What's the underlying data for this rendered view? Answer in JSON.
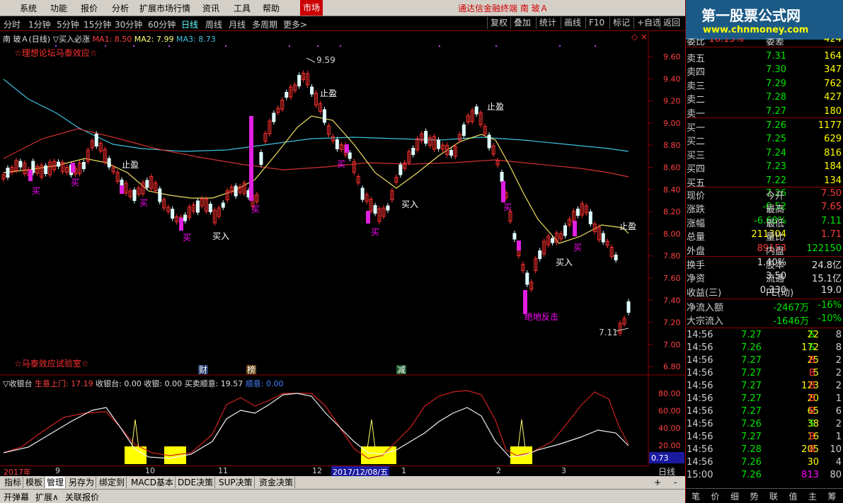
{
  "menu": [
    "系统",
    "功能",
    "报价",
    "分析",
    "扩展市场行情",
    "资讯",
    "工具",
    "帮助"
  ],
  "market_tag": "市场",
  "app_title": "通达信金融终端 南 玻Ａ",
  "periods": [
    "分时",
    "1分钟",
    "5分钟",
    "15分钟",
    "30分钟",
    "60分钟",
    "日线",
    "周线",
    "月线",
    "多周期",
    "更多>"
  ],
  "active_period": "日线",
  "toolbar": [
    "复权",
    "叠加",
    "统计",
    "画线",
    "F10",
    "标记",
    "+自选",
    "返回"
  ],
  "header": {
    "stock": "南 玻Ａ(日线)",
    "indicator": "▽买入必涨",
    "ma1": "MA1: 8.50",
    "ma2": "MA2: 7.99",
    "ma3": "MA3: 8.73"
  },
  "annotations": {
    "forum": "☆理想论坛马泰效应☆",
    "lab": "☆马泰效应试验室☆",
    "high_price": "9.59",
    "low_price": "7.11",
    "buy": "买",
    "buy_in": "买入",
    "stop_profit": "止盈",
    "rebound": "绝地反击",
    "event_cai": "财",
    "event_bang": "榜",
    "event_jian": "减"
  },
  "price_axis": [
    "9.60",
    "9.40",
    "9.20",
    "9.00",
    "8.80",
    "8.60",
    "8.40",
    "8.20",
    "8.00",
    "7.80",
    "7.60",
    "7.40",
    "7.20",
    "7.00",
    "6.80"
  ],
  "sub_header": {
    "name": "▽收银台",
    "a": "生意上门: 17.19",
    "b": "收银台: 0.00",
    "c": "收银: 0.00",
    "d": "买卖顺意: 19.57",
    "e": "顺意: 0.00"
  },
  "sub_axis": [
    "80.00",
    "60.00",
    "40.00",
    "20.00"
  ],
  "sub_value_box": "0.73",
  "dates": {
    "y": "2017年",
    "m9": "9",
    "m10": "10",
    "m11": "11",
    "m12": "12",
    "cursor": "2017/12/08/五",
    "m1": "1",
    "m2": "2",
    "m3": "3"
  },
  "period_label": "日线",
  "tabs": [
    "指标",
    "模板",
    "管理",
    "另存为",
    "绑定到",
    "MACD基本",
    "DDE决策",
    "SUP决策",
    "资金决策"
  ],
  "active_tab": "管理",
  "status_buttons": [
    "开弹幕",
    "扩展∧",
    "关联报价"
  ],
  "logo": {
    "title": "第一股票公式网",
    "url": "www.chnmoney.com"
  },
  "quote": {
    "top_partial": {
      "label": "委比",
      "val": "16.13%",
      "label2": "委差",
      "val2": "424"
    },
    "asks": [
      {
        "label": "卖五",
        "price": "7.31",
        "vol": "164"
      },
      {
        "label": "卖四",
        "price": "7.30",
        "vol": "347"
      },
      {
        "label": "卖三",
        "price": "7.29",
        "vol": "762"
      },
      {
        "label": "卖二",
        "price": "7.28",
        "vol": "427"
      },
      {
        "label": "卖一",
        "price": "7.27",
        "vol": "180"
      }
    ],
    "bids": [
      {
        "label": "买一",
        "price": "7.26",
        "vol": "1177"
      },
      {
        "label": "买二",
        "price": "7.25",
        "vol": "629"
      },
      {
        "label": "买三",
        "price": "7.24",
        "vol": "816"
      },
      {
        "label": "买四",
        "price": "7.23",
        "vol": "184"
      },
      {
        "label": "买五",
        "price": "7.22",
        "vol": "134"
      }
    ],
    "stats": [
      {
        "l1": "现价",
        "v1": "7.26",
        "l2": "今开",
        "v2": "7.50"
      },
      {
        "l1": "涨跌",
        "v1": "-0.52",
        "l2": "最高",
        "v2": "7.65"
      },
      {
        "l1": "涨幅",
        "v1": "-6.68%",
        "l2": "最低",
        "v2": "7.11"
      },
      {
        "l1": "总量",
        "v1": "211304",
        "l2": "量比",
        "v2": "1.71"
      },
      {
        "l1": "外盘",
        "v1": "89153",
        "l2": "内盘",
        "v2": "122150"
      }
    ],
    "stats2": [
      {
        "l1": "换手",
        "v1": "1.40%",
        "l2": "股本",
        "v2": "24.8亿"
      },
      {
        "l1": "净资",
        "v1": "3.50",
        "l2": "流通",
        "v2": "15.1亿"
      },
      {
        "l1": "收益(三)",
        "v1": "0.330",
        "l2": "PE(动)",
        "v2": "19.0"
      }
    ],
    "flows": [
      {
        "label": "净流入额",
        "val": "-2467万",
        "pct": "-16%"
      },
      {
        "label": "大宗流入",
        "val": "-1646万",
        "pct": "-10%"
      }
    ]
  },
  "ticks": [
    {
      "t": "14:56",
      "p": "7.27",
      "v": "22",
      "bs": "S",
      "x": "8"
    },
    {
      "t": "14:56",
      "p": "7.26",
      "v": "172",
      "bs": "S",
      "x": "8"
    },
    {
      "t": "14:56",
      "p": "7.27",
      "v": "25",
      "bs": "B",
      "x": "2"
    },
    {
      "t": "14:56",
      "p": "7.27",
      "v": "5",
      "bs": "B",
      "x": "2"
    },
    {
      "t": "14:56",
      "p": "7.27",
      "v": "123",
      "bs": "B",
      "x": "2"
    },
    {
      "t": "14:56",
      "p": "7.27",
      "v": "20",
      "bs": "B",
      "x": "1"
    },
    {
      "t": "14:56",
      "p": "7.27",
      "v": "65",
      "bs": "B",
      "x": "6"
    },
    {
      "t": "14:56",
      "p": "7.26",
      "v": "38",
      "bs": "S",
      "x": "2"
    },
    {
      "t": "14:56",
      "p": "7.27",
      "v": "16",
      "bs": "B",
      "x": "1"
    },
    {
      "t": "14:56",
      "p": "7.28",
      "v": "205",
      "bs": "B",
      "x": "10"
    },
    {
      "t": "14:56",
      "p": "7.26",
      "v": "30",
      "bs": "",
      "x": "4"
    },
    {
      "t": "15:00",
      "p": "7.26",
      "v": "813",
      "bs": "",
      "x": "80"
    }
  ],
  "right_tabs": [
    "笔",
    "价",
    "细",
    "势",
    "联",
    "值",
    "主",
    "筹"
  ]
}
